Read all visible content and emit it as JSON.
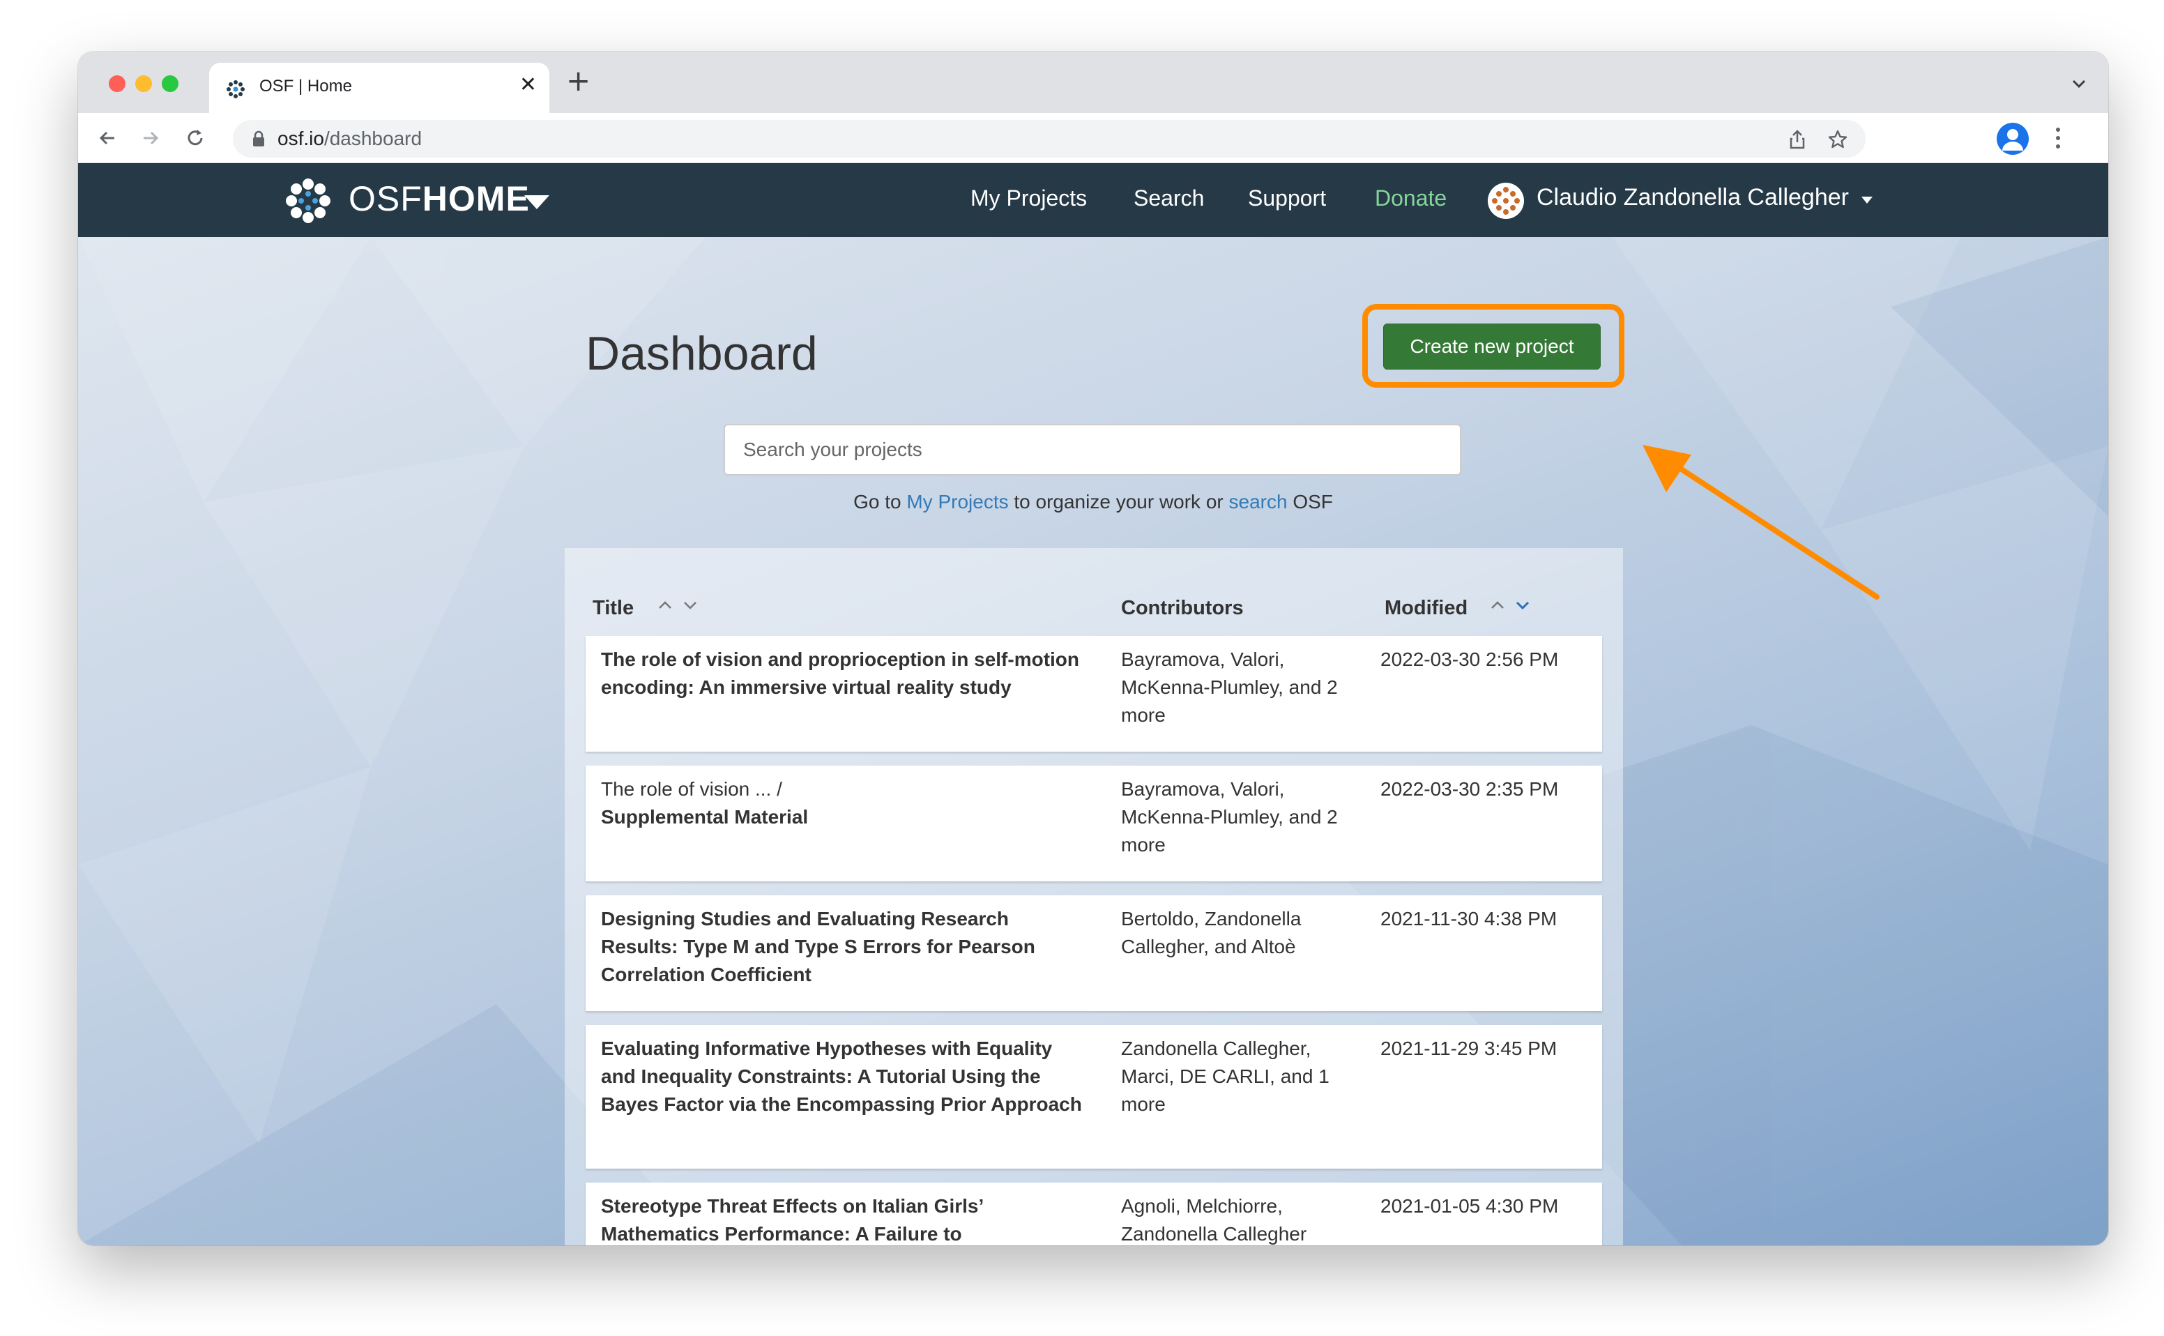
{
  "browser": {
    "tab_title": "OSF | Home",
    "url_domain": "osf.io",
    "url_path": "/dashboard"
  },
  "navbar": {
    "brand_light": "OSF",
    "brand_bold": "HOME",
    "links": [
      "My Projects",
      "Search",
      "Support",
      "Donate"
    ],
    "user_name": "Claudio Zandonella Callegher"
  },
  "page": {
    "title": "Dashboard",
    "create_button": "Create new project",
    "search_placeholder": "Search your projects",
    "helper_pre": "Go to ",
    "helper_link1": "My Projects",
    "helper_mid": " to organize your work or ",
    "helper_link2": "search",
    "helper_post": " OSF"
  },
  "table": {
    "headers": {
      "title": "Title",
      "contributors": "Contributors",
      "modified": "Modified"
    },
    "rows": [
      {
        "parent": "",
        "title": "The role of vision and proprioception in self-motion encoding: An immersive virtual reality study",
        "contributors": "Bayramova, Valori, McKenna-Plumley, and 2 more",
        "modified": "2022-03-30 2:56 PM"
      },
      {
        "parent": "The role of vision ...    /",
        "title": "Supplemental Material",
        "contributors": "Bayramova, Valori, McKenna-Plumley, and 2 more",
        "modified": "2022-03-30 2:35 PM"
      },
      {
        "parent": "",
        "title": "Designing Studies and Evaluating Research Results: Type M and Type S Errors for Pearson Correlation Coefficient",
        "contributors": "Bertoldo, Zandonella Callegher, and Altoè",
        "modified": "2021-11-30 4:38 PM"
      },
      {
        "parent": "",
        "title": "Evaluating Informative Hypotheses with Equality and Inequality Constraints: A Tutorial Using the Bayes Factor via the Encompassing Prior Approach",
        "contributors": "Zandonella Callegher, Marci, DE CARLI, and 1 more",
        "modified": "2021-11-29 3:45 PM"
      },
      {
        "parent": "",
        "title": "Stereotype Threat Effects on Italian Girls’ Mathematics Performance: A Failure to",
        "contributors": "Agnoli, Melchiorre, Zandonella Callegher",
        "modified": "2021-01-05 4:30 PM"
      }
    ]
  },
  "colors": {
    "navbar": "#263947",
    "button": "#357937",
    "highlight": "#ff8c00",
    "link": "#337ab7"
  }
}
